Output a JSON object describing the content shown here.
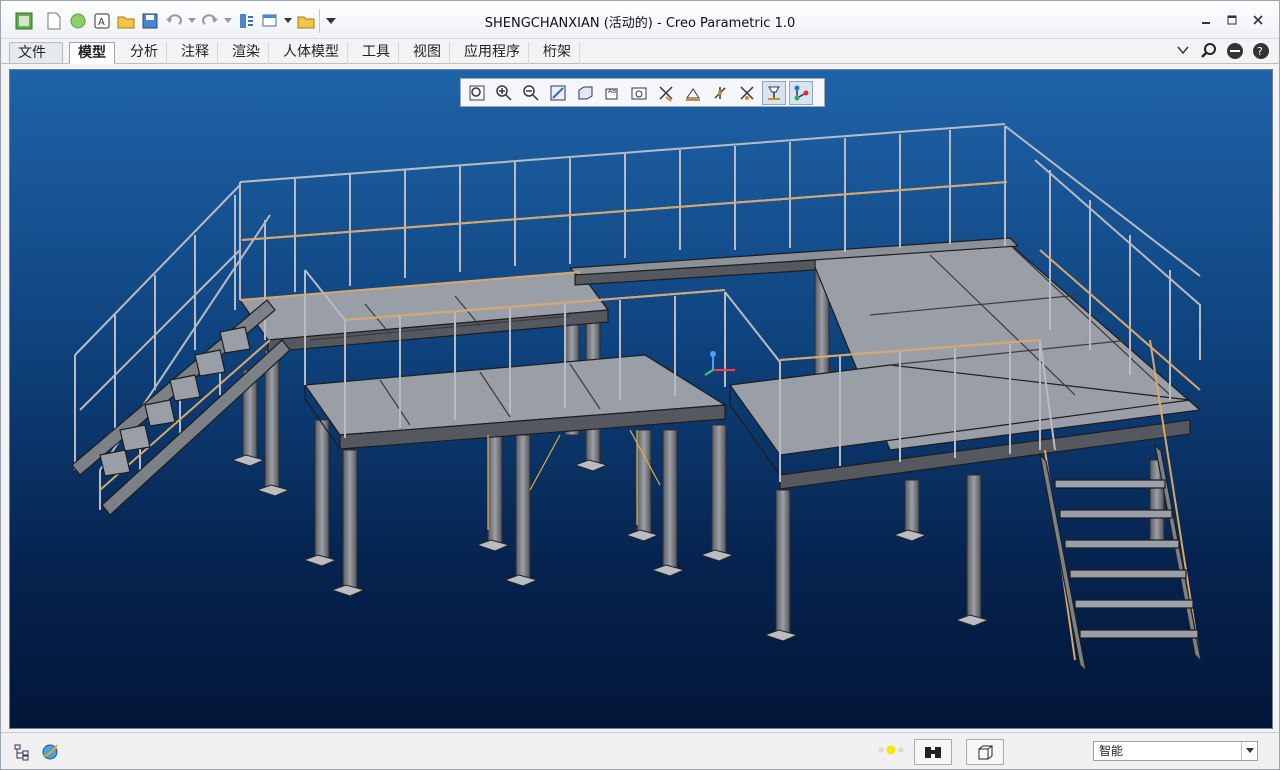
{
  "window": {
    "title": "SHENGCHANXIAN (活动的) - Creo Parametric 1.0"
  },
  "quick_access": {
    "icons": [
      "app-icon",
      "new-icon",
      "open-sphere-icon",
      "open-file-icon",
      "open-folder-icon",
      "save-icon",
      "undo-icon",
      "redo-icon",
      "regenerate-icon",
      "windows-icon",
      "close-icon",
      "customize-icon"
    ]
  },
  "ribbon": {
    "file_label": "文件",
    "tabs": [
      {
        "label": "模型",
        "active": true
      },
      {
        "label": "分析"
      },
      {
        "label": "注释"
      },
      {
        "label": "渲染"
      },
      {
        "label": "人体模型"
      },
      {
        "label": "工具"
      },
      {
        "label": "视图"
      },
      {
        "label": "应用程序"
      },
      {
        "label": "桁架"
      }
    ],
    "right_icons": [
      "minimize-ribbon-icon",
      "search-icon",
      "help-icon",
      "settings-icon"
    ]
  },
  "graphics_toolbar": {
    "buttons": [
      "refit-icon",
      "zoom-in-icon",
      "zoom-out-icon",
      "repaint-icon",
      "display-style-icon",
      "saved-views-icon",
      "view-manager-icon",
      "datum-display-icon",
      "annotation-display-icon",
      "spin-center-icon",
      "datum-points-icon",
      "plane-display-icon",
      "csys-display-icon"
    ],
    "active": [
      "plane-display-icon",
      "csys-display-icon"
    ]
  },
  "status_bar": {
    "filter_value": "智能"
  },
  "colors": {
    "viewport_top": "#1f63a8",
    "viewport_bottom": "#021638",
    "steel": "#8a8d93",
    "rail_accent": "#d8a86a"
  }
}
